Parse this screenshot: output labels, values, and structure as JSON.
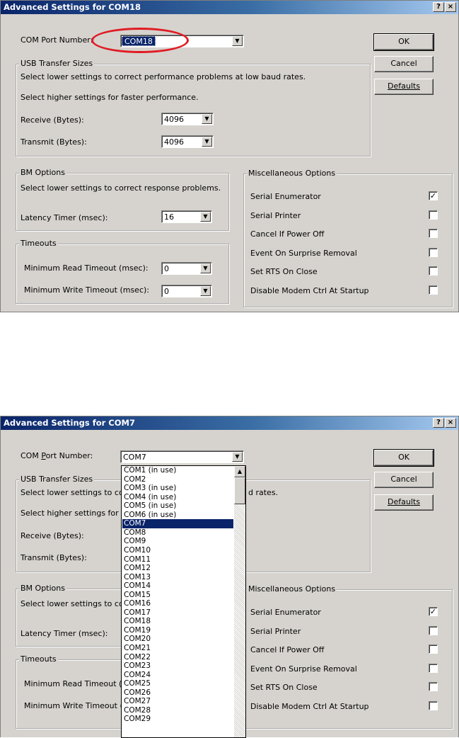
{
  "dialog1": {
    "title": "Advanced Settings for COM18",
    "help_btn": "?",
    "close_btn": "×",
    "com_port_label": "COM Port Number:",
    "com_port_value": "COM18",
    "arrow": "▼",
    "ok": "OK",
    "cancel": "Cancel",
    "defaults": "Defaults",
    "usb_group": "USB Transfer Sizes",
    "usb_line1": "Select lower settings to correct performance problems at low baud rates.",
    "usb_line2": "Select higher settings for faster performance.",
    "receive_label": "Receive (Bytes):",
    "receive_value": "4096",
    "transmit_label": "Transmit (Bytes):",
    "transmit_value": "4096",
    "bm_group": "BM Options",
    "bm_line": "Select lower settings to correct response problems.",
    "latency_label": "Latency Timer (msec):",
    "latency_value": "16",
    "timeouts_group": "Timeouts",
    "min_read_label": "Minimum Read Timeout (msec):",
    "min_read_value": "0",
    "min_write_label": "Minimum Write Timeout (msec):",
    "min_write_value": "0",
    "misc_group": "Miscellaneous Options",
    "misc": [
      {
        "label": "Serial Enumerator",
        "checked": true
      },
      {
        "label": "Serial Printer",
        "checked": false
      },
      {
        "label": "Cancel If Power Off",
        "checked": false
      },
      {
        "label": "Event On Surprise Removal",
        "checked": false
      },
      {
        "label": "Set RTS On Close",
        "checked": false
      },
      {
        "label": "Disable Modem Ctrl At Startup",
        "checked": false
      }
    ],
    "checkmark": "✓"
  },
  "dialog2": {
    "title": "Advanced Settings for COM7",
    "help_btn": "?",
    "close_btn": "×",
    "com_port_label_pre": "COM ",
    "com_port_label_u": "P",
    "com_port_label_post": "ort Number:",
    "com_port_value": "COM7",
    "arrow": "▼",
    "ok": "OK",
    "cancel": "Cancel",
    "defaults": "Defaults",
    "usb_group": "USB Transfer Sizes",
    "usb_line1_visible": "Select lower settings to corre",
    "usb_line1_tail": "d rates.",
    "usb_line2_visible": "Select higher settings for fas",
    "receive_label": "Receive (Bytes):",
    "transmit_label": "Transmit (Bytes):",
    "bm_group": "BM Options",
    "bm_line_visible": "Select lower settings to corre",
    "latency_label": "Latency Timer (msec):",
    "timeouts_group": "Timeouts",
    "min_read_visible": "Minimum Read Timeout (mse",
    "min_write_visible": "Minimum Write Timeout (mse",
    "misc_group": "Miscellaneous Options",
    "misc": [
      {
        "label": "Serial Enumerator",
        "checked": true
      },
      {
        "label": "Serial Printer",
        "checked": false
      },
      {
        "label": "Cancel If Power Off",
        "checked": false
      },
      {
        "label": "Event On Surprise Removal",
        "checked": false
      },
      {
        "label": "Set RTS On Close",
        "checked": false
      },
      {
        "label": "Disable Modem Ctrl At Startup",
        "checked": false
      }
    ],
    "checkmark": "✓",
    "dropdown_items": [
      "COM1 (in use)",
      "COM2",
      "COM3 (in use)",
      "COM4 (in use)",
      "COM5 (in use)",
      "COM6 (in use)",
      "COM7",
      "COM8",
      "COM9",
      "COM10",
      "COM11",
      "COM12",
      "COM13",
      "COM14",
      "COM15",
      "COM16",
      "COM17",
      "COM18",
      "COM19",
      "COM20",
      "COM21",
      "COM22",
      "COM23",
      "COM24",
      "COM25",
      "COM26",
      "COM27",
      "COM28",
      "COM29"
    ],
    "dropdown_selected": "COM7",
    "scroll_up": "▲"
  },
  "colors": {
    "highlight": "#0a246a",
    "annotation": "#e01b24",
    "dialog_bg": "#d6d3ce"
  }
}
